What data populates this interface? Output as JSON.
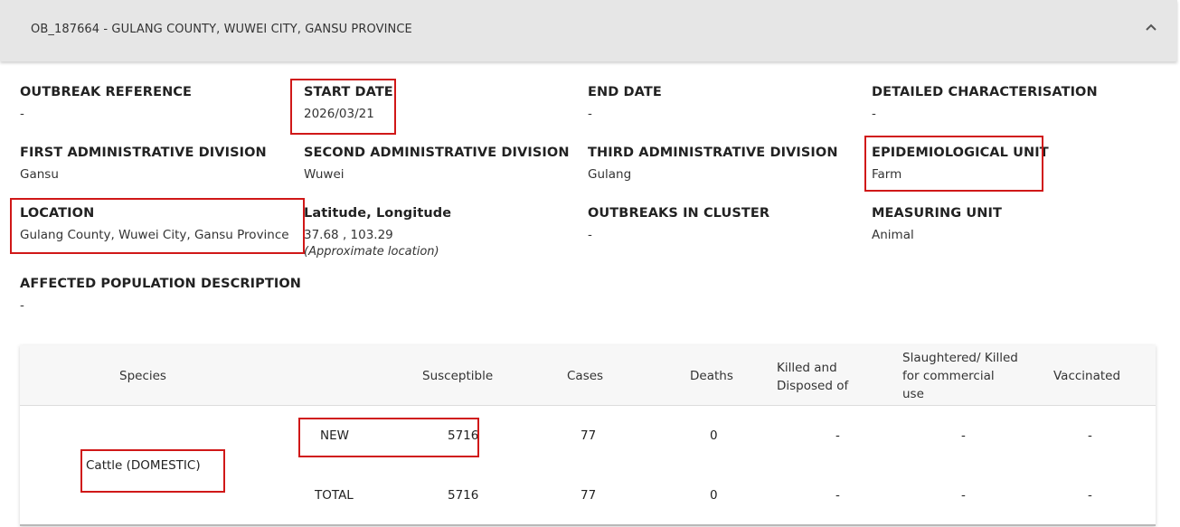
{
  "header": {
    "title": "OB_187664 - GULANG COUNTY, WUWEI CITY, GANSU PROVINCE"
  },
  "fields": {
    "outbreak_reference": {
      "label": "OUTBREAK REFERENCE",
      "value": "-"
    },
    "start_date": {
      "label": "START DATE",
      "value": "2026/03/21"
    },
    "end_date": {
      "label": "END DATE",
      "value": "-"
    },
    "detailed_characterisation": {
      "label": "DETAILED CHARACTERISATION",
      "value": "-"
    },
    "first_admin": {
      "label": "FIRST ADMINISTRATIVE DIVISION",
      "value": "Gansu"
    },
    "second_admin": {
      "label": "SECOND ADMINISTRATIVE DIVISION",
      "value": "Wuwei"
    },
    "third_admin": {
      "label": "THIRD ADMINISTRATIVE DIVISION",
      "value": "Gulang"
    },
    "epi_unit": {
      "label": "EPIDEMIOLOGICAL UNIT",
      "value": "Farm"
    },
    "location": {
      "label": "LOCATION",
      "value": "Gulang County, Wuwei City, Gansu Province"
    },
    "lat_long": {
      "label": "Latitude, Longitude",
      "value": "37.68 , 103.29",
      "note": "(Approximate location)"
    },
    "outbreaks_in_cluster": {
      "label": "OUTBREAKS IN CLUSTER",
      "value": "-"
    },
    "measuring_unit": {
      "label": "MEASURING UNIT",
      "value": "Animal"
    },
    "affected_population": {
      "label": "AFFECTED POPULATION DESCRIPTION",
      "value": "-"
    }
  },
  "table": {
    "columns": {
      "species": "Species",
      "susceptible": "Susceptible",
      "cases": "Cases",
      "deaths": "Deaths",
      "killed_l1": "Killed and",
      "killed_l2": "Disposed of",
      "slaughtered_l1": "Slaughtered/ Killed",
      "slaughtered_l2": "for commercial",
      "slaughtered_l3": "use",
      "vaccinated": "Vaccinated"
    },
    "species": "Cattle (DOMESTIC)",
    "rows": [
      {
        "type": "NEW",
        "susceptible": "5716",
        "cases": "77",
        "deaths": "0",
        "killed": "-",
        "slaughtered": "-",
        "vaccinated": "-"
      },
      {
        "type": "TOTAL",
        "susceptible": "5716",
        "cases": "77",
        "deaths": "0",
        "killed": "-",
        "slaughtered": "-",
        "vaccinated": "-"
      }
    ]
  },
  "colors": {
    "highlight_box": "#d01818",
    "header_bg": "#e6e6e6"
  },
  "icons": {
    "collapse": "chevron-up-icon"
  }
}
